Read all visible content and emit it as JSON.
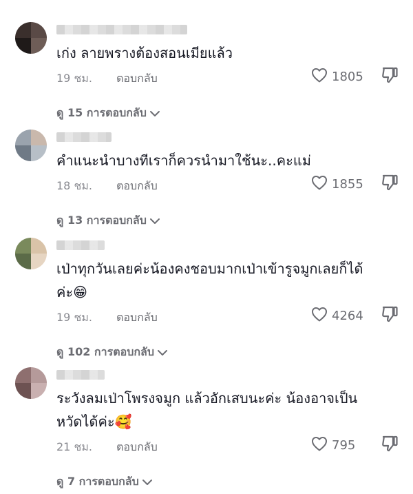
{
  "comments": [
    {
      "text": "เก่ง ลายพรางต้องสอนเมียแล้ว",
      "time": "19 ชม.",
      "reply_label": "ตอบกลับ",
      "likes": "1805",
      "view_replies": "ดู 15 การตอบกลับ",
      "avatar_colors": [
        "#3a2f2c",
        "#5a4a46",
        "#1f1a19",
        "#6e5d57"
      ]
    },
    {
      "text": "คำแนะนำบางทีเราก็ควรนำมาใช้นะ..คะแม่",
      "time": "18 ชม.",
      "reply_label": "ตอบกลับ",
      "likes": "1855",
      "view_replies": "ดู 13 การตอบกลับ",
      "avatar_colors": [
        "#9aa3ad",
        "#c9b8ac",
        "#6f7a86",
        "#b7bfc7"
      ]
    },
    {
      "text": "เป่าทุกวันเลยค่ะน้องคงชอบมากเป่าเข้ารูจมูกเลยก็ได้\nค่ะ😁",
      "time": "19 ชม.",
      "reply_label": "ตอบกลับ",
      "likes": "4264",
      "view_replies": "ดู 102 การตอบกลับ",
      "avatar_colors": [
        "#7a8a5c",
        "#d9c3a8",
        "#5b6b48",
        "#e6d5c2"
      ]
    },
    {
      "text": "ระวังลมเป่าโพรงจมูก แล้วอักเสบนะค่ะ น้องอาจเป็น\nหวัดได้ค่ะ🥰",
      "time": "21 ชม.",
      "reply_label": "ตอบกลับ",
      "likes": "795",
      "view_replies": "ดู 7 การตอบกลับ",
      "avatar_colors": [
        "#8e6f6f",
        "#b59a9a",
        "#6d5252",
        "#c9b0b0"
      ]
    }
  ],
  "icons": {
    "like": "heart-outline-icon",
    "dislike": "thumbs-down-outline-icon",
    "expand": "chevron-down-icon"
  },
  "colors": {
    "text": "#161823",
    "muted": "#8a8b91",
    "icon": "#6b6c72"
  }
}
